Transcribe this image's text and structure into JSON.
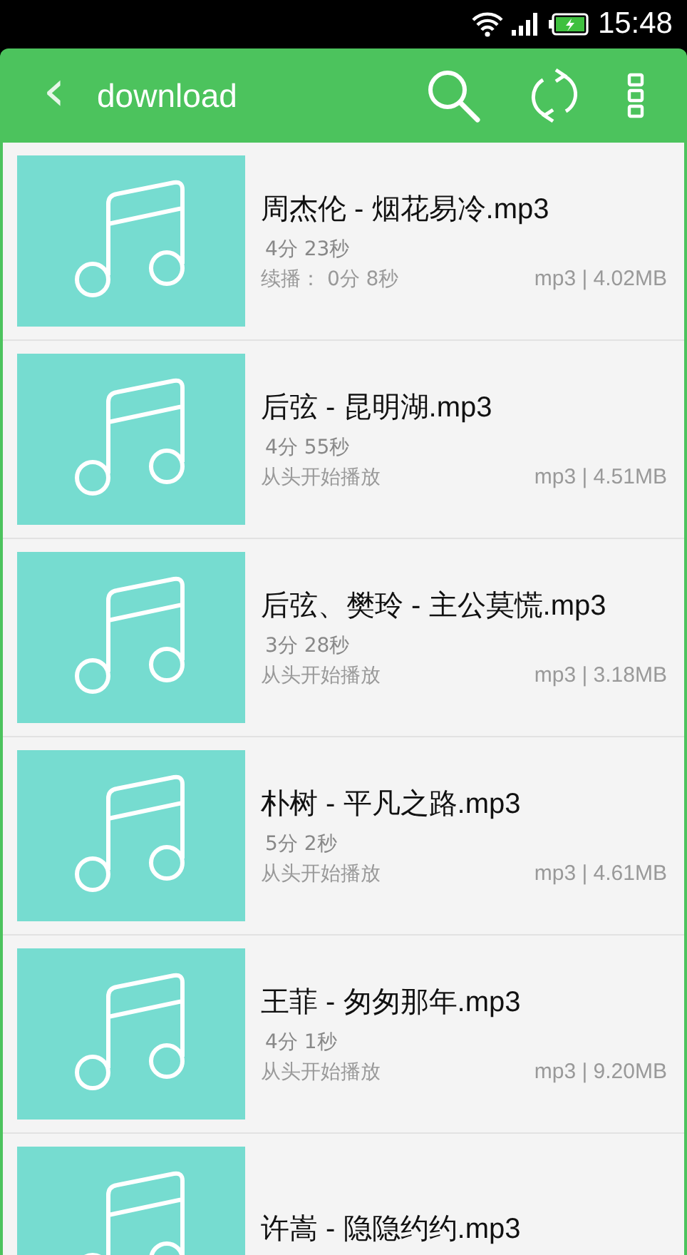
{
  "status_bar": {
    "time": "15:48",
    "battery_charging": true
  },
  "app_bar": {
    "back": "‹",
    "title": "download"
  },
  "tracks": [
    {
      "title": "周杰伦 - 烟花易冷.mp3",
      "duration": "4分 23秒",
      "progress": "续播： 0分  8秒",
      "info": "mp3 | 4.02MB"
    },
    {
      "title": "后弦 - 昆明湖.mp3",
      "duration": "4分 55秒",
      "progress": "从头开始播放",
      "info": "mp3 | 4.51MB"
    },
    {
      "title": "后弦、樊玲 - 主公莫慌.mp3",
      "duration": "3分 28秒",
      "progress": "从头开始播放",
      "info": "mp3 | 3.18MB"
    },
    {
      "title": "朴树 - 平凡之路.mp3",
      "duration": "5分  2秒",
      "progress": "从头开始播放",
      "info": "mp3 | 4.61MB"
    },
    {
      "title": "王菲 - 匆匆那年.mp3",
      "duration": "4分  1秒",
      "progress": "从头开始播放",
      "info": "mp3 | 9.20MB"
    },
    {
      "title": "许嵩 - 隐隐约约.mp3"
    }
  ]
}
